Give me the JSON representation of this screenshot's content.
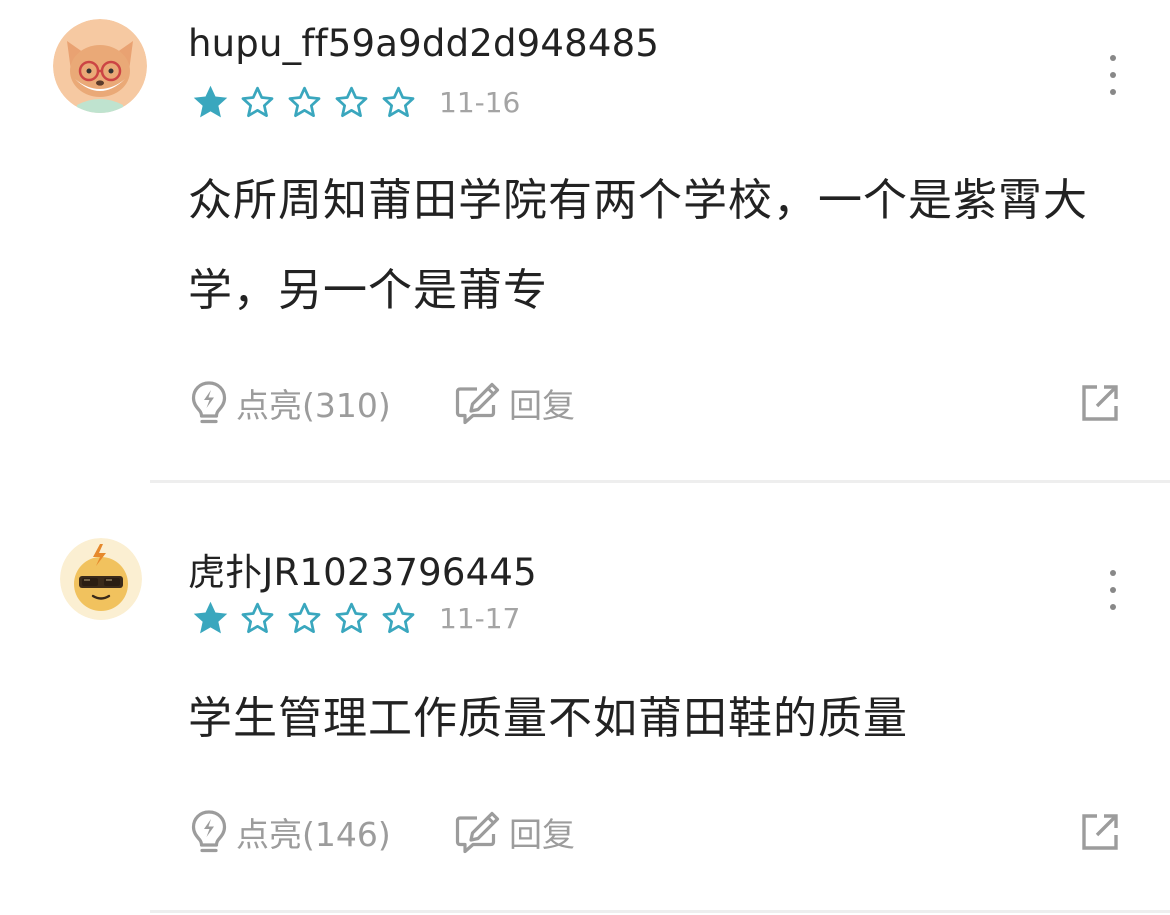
{
  "colors": {
    "star_filled": "#3aa7be",
    "star_outline": "#3aa7be",
    "meta_gray": "#a4a4a4",
    "action_gray": "#9c9c9c",
    "text": "#222222"
  },
  "comments": [
    {
      "username": "hupu_ff59a9dd2d948485",
      "avatar_icon": "fox-with-glasses-avatar",
      "rating": 1,
      "rating_max": 5,
      "date": "11-16",
      "content": "众所周知莆田学院有两个学校，一个是紫霄大学，另一个是莆专",
      "light_icon": "lightbulb-icon",
      "light_label": "点亮(310)",
      "reply_icon": "edit-reply-icon",
      "reply_label": "回复",
      "share_icon": "share-external-icon",
      "more_icon": "more-vertical-icon"
    },
    {
      "username": "虎扑JR1023796445",
      "avatar_icon": "sunglasses-bolt-avatar",
      "rating": 1,
      "rating_max": 5,
      "date": "11-17",
      "content": "学生管理工作质量不如莆田鞋的质量",
      "light_icon": "lightbulb-icon",
      "light_label": "点亮(146)",
      "reply_icon": "edit-reply-icon",
      "reply_label": "回复",
      "share_icon": "share-external-icon",
      "more_icon": "more-vertical-icon"
    }
  ]
}
